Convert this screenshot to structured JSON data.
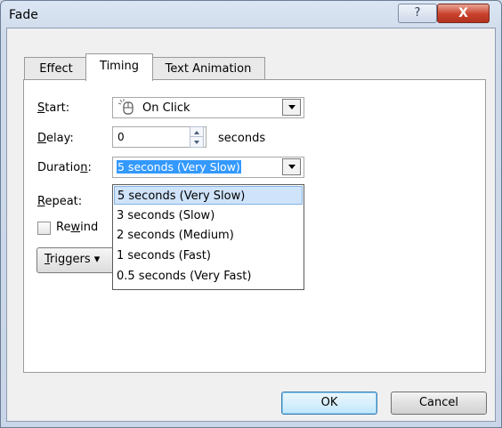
{
  "window": {
    "title": "Fade",
    "help_label": "?",
    "close_label": "X"
  },
  "tabs": [
    {
      "label": "Effect",
      "active": false
    },
    {
      "label": "Timing",
      "active": true
    },
    {
      "label": "Text Animation",
      "active": false
    }
  ],
  "timing": {
    "start": {
      "label": "Start:",
      "value": "On Click",
      "icon": "mouse-click-icon"
    },
    "delay": {
      "label": "Delay:",
      "value": "0",
      "unit": "seconds"
    },
    "duration": {
      "label": "Duration:",
      "value": "5 seconds (Very Slow)"
    },
    "repeat": {
      "label": "Repeat:"
    },
    "rewind": {
      "label": "Rewind",
      "checked": false
    },
    "triggers_label": "Triggers"
  },
  "duration_options": [
    "5 seconds (Very Slow)",
    "3 seconds (Slow)",
    "2 seconds (Medium)",
    "1 seconds (Fast)",
    "0.5 seconds (Very Fast)"
  ],
  "duration_selected_index": 0,
  "buttons": {
    "ok": "OK",
    "cancel": "Cancel"
  }
}
